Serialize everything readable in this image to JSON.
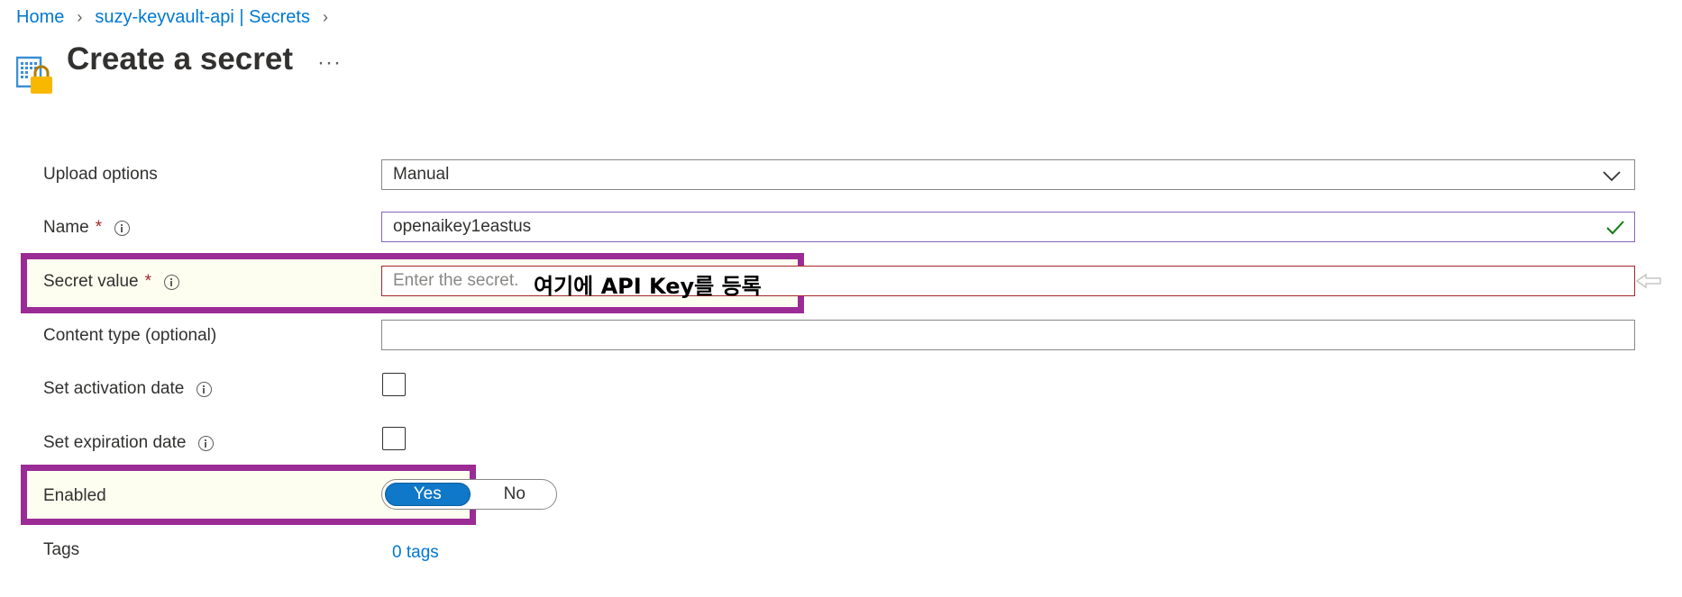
{
  "breadcrumb": {
    "items": [
      "Home",
      "suzy-keyvault-api | Secrets"
    ]
  },
  "page": {
    "title": "Create a secret",
    "more_label": "···",
    "icon": "keyvault-secret-icon"
  },
  "form": {
    "upload_options": {
      "label": "Upload options",
      "value": "Manual"
    },
    "name": {
      "label": "Name",
      "required_mark": "*",
      "value": "openaikey1eastus"
    },
    "secret_value": {
      "label": "Secret value",
      "required_mark": "*",
      "placeholder": "Enter the secret."
    },
    "content_type": {
      "label": "Content type (optional)",
      "value": ""
    },
    "activation_date": {
      "label": "Set activation date",
      "checked": false
    },
    "expiration_date": {
      "label": "Set expiration date",
      "checked": false
    },
    "enabled": {
      "label": "Enabled",
      "yes": "Yes",
      "no": "No",
      "selected": "Yes"
    },
    "tags": {
      "label": "Tags",
      "link": "0 tags"
    }
  },
  "annotation": {
    "text": "여기에 API Key를 등록",
    "color": "#9b2b95"
  },
  "colors": {
    "link": "#0078d4",
    "accent": "#0f78c8",
    "error_border": "#a4262c",
    "success_check": "#107c10"
  }
}
